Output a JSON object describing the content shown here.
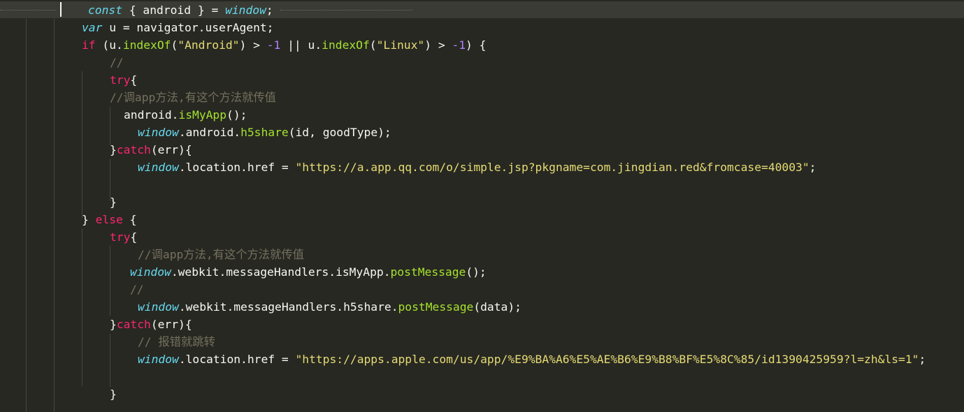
{
  "editor": {
    "theme_colors": {
      "background": "#272822",
      "keyword": "#f92672",
      "storage": "#66d9ef",
      "function": "#a6e22e",
      "string": "#e6db74",
      "number": "#ae81ff",
      "comment": "#75715e",
      "plain": "#f8f8f2"
    },
    "lines": [
      {
        "indent": 126,
        "tokens": [
          {
            "t": "st",
            "v": "const"
          },
          {
            "t": "pl",
            "v": " { android } = "
          },
          {
            "t": "st",
            "v": "window"
          },
          {
            "t": "pl",
            "v": ";"
          }
        ]
      },
      {
        "indent": 117,
        "tokens": [
          {
            "t": "st",
            "v": "var"
          },
          {
            "t": "pl",
            "v": " u = navigator.userAgent;"
          }
        ]
      },
      {
        "indent": 117,
        "tokens": [
          {
            "t": "kw",
            "v": "if"
          },
          {
            "t": "pl",
            "v": " (u."
          },
          {
            "t": "fn",
            "v": "indexOf"
          },
          {
            "t": "pl",
            "v": "("
          },
          {
            "t": "str",
            "v": "\"Android\""
          },
          {
            "t": "pl",
            "v": ") > "
          },
          {
            "t": "num",
            "v": "-1"
          },
          {
            "t": "pl",
            "v": " || u."
          },
          {
            "t": "fn",
            "v": "indexOf"
          },
          {
            "t": "pl",
            "v": "("
          },
          {
            "t": "str",
            "v": "\"Linux\""
          },
          {
            "t": "pl",
            "v": ") > "
          },
          {
            "t": "num",
            "v": "-1"
          },
          {
            "t": "pl",
            "v": ") {"
          }
        ]
      },
      {
        "indent": 157,
        "tokens": [
          {
            "t": "cm",
            "v": "//"
          }
        ]
      },
      {
        "indent": 157,
        "tokens": [
          {
            "t": "kw",
            "v": "try"
          },
          {
            "t": "pl",
            "v": "{"
          }
        ]
      },
      {
        "indent": 157,
        "tokens": [
          {
            "t": "cm",
            "v": "//调app方法,有这个方法就传值"
          }
        ]
      },
      {
        "indent": 177,
        "tokens": [
          {
            "t": "pl",
            "v": "android."
          },
          {
            "t": "fn",
            "v": "isMyApp"
          },
          {
            "t": "pl",
            "v": "();"
          }
        ]
      },
      {
        "indent": 197,
        "tokens": [
          {
            "t": "st",
            "v": "window"
          },
          {
            "t": "pl",
            "v": ".android."
          },
          {
            "t": "fn",
            "v": "h5share"
          },
          {
            "t": "pl",
            "v": "(id, goodType);"
          }
        ]
      },
      {
        "indent": 157,
        "tokens": [
          {
            "t": "pl",
            "v": "}"
          },
          {
            "t": "kw",
            "v": "catch"
          },
          {
            "t": "pl",
            "v": "(err){"
          }
        ]
      },
      {
        "indent": 197,
        "tokens": [
          {
            "t": "st",
            "v": "window"
          },
          {
            "t": "pl",
            "v": ".location.href = "
          },
          {
            "t": "str",
            "v": "\"https://a.app.qq.com/o/simple.jsp?pkgname=com.jingdian.red&fromcase=40003\""
          },
          {
            "t": "pl",
            "v": ";"
          }
        ]
      },
      {
        "indent": 157,
        "tokens": []
      },
      {
        "indent": 157,
        "tokens": [
          {
            "t": "pl",
            "v": "}"
          }
        ]
      },
      {
        "indent": 117,
        "tokens": [
          {
            "t": "pl",
            "v": "} "
          },
          {
            "t": "kw",
            "v": "else"
          },
          {
            "t": "pl",
            "v": " {"
          }
        ]
      },
      {
        "indent": 157,
        "tokens": [
          {
            "t": "kw",
            "v": "try"
          },
          {
            "t": "pl",
            "v": "{"
          }
        ]
      },
      {
        "indent": 197,
        "tokens": [
          {
            "t": "cm",
            "v": "//调app方法,有这个方法就传值"
          }
        ]
      },
      {
        "indent": 186,
        "tokens": [
          {
            "t": "st",
            "v": "window"
          },
          {
            "t": "pl",
            "v": ".webkit.messageHandlers.isMyApp."
          },
          {
            "t": "fn",
            "v": "postMessage"
          },
          {
            "t": "pl",
            "v": "();"
          }
        ]
      },
      {
        "indent": 186,
        "tokens": [
          {
            "t": "cm",
            "v": "//"
          }
        ]
      },
      {
        "indent": 197,
        "tokens": [
          {
            "t": "st",
            "v": "window"
          },
          {
            "t": "pl",
            "v": ".webkit.messageHandlers.h5share."
          },
          {
            "t": "fn",
            "v": "postMessage"
          },
          {
            "t": "pl",
            "v": "(data);"
          }
        ]
      },
      {
        "indent": 157,
        "tokens": [
          {
            "t": "pl",
            "v": "}"
          },
          {
            "t": "kw",
            "v": "catch"
          },
          {
            "t": "pl",
            "v": "(err){"
          }
        ]
      },
      {
        "indent": 197,
        "tokens": [
          {
            "t": "cm",
            "v": "// 报错就跳转"
          }
        ]
      },
      {
        "indent": 197,
        "tokens": [
          {
            "t": "st",
            "v": "window"
          },
          {
            "t": "pl",
            "v": ".location.href = "
          },
          {
            "t": "str",
            "v": "\"https://apps.apple.com/us/app/%E9%BA%A6%E5%AE%B6%E9%B8%BF%E5%8C%85/id1390425959?l=zh&ls=1\""
          },
          {
            "t": "pl",
            "v": ";"
          }
        ]
      },
      {
        "indent": 157,
        "tokens": []
      },
      {
        "indent": 157,
        "tokens": [
          {
            "t": "pl",
            "v": "}"
          }
        ]
      }
    ]
  }
}
